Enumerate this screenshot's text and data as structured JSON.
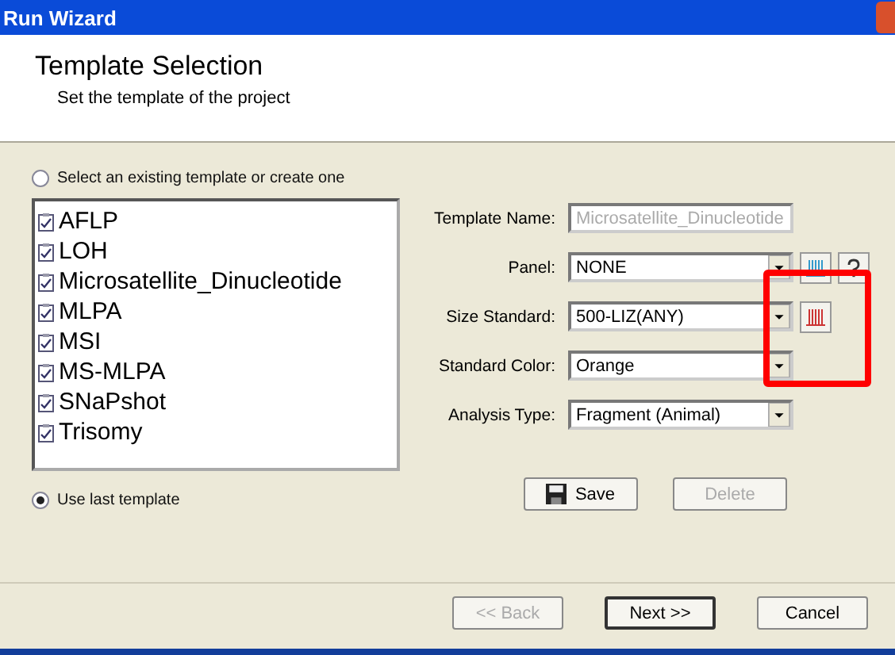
{
  "window": {
    "title": "Run Wizard"
  },
  "header": {
    "title": "Template Selection",
    "subtitle": "Set the template of the project"
  },
  "options": [
    {
      "label": "Select an existing template or create one",
      "selected": false
    },
    {
      "label": "Use last template",
      "selected": true
    }
  ],
  "templates": [
    "AFLP",
    "LOH",
    "Microsatellite_Dinucleotide",
    "MLPA",
    "MSI",
    "MS-MLPA",
    "SNaPshot",
    "Trisomy"
  ],
  "form": [
    {
      "label": "Template Name:",
      "kind": "text",
      "value": "Microsatellite_Dinucleotide",
      "disabled": true
    },
    {
      "label": "Panel:",
      "kind": "select",
      "value": "NONE",
      "disabled": false,
      "tools": [
        {
          "kind": "bars",
          "color": "#3399cc"
        },
        {
          "kind": "help"
        }
      ]
    },
    {
      "label": "Size Standard:",
      "kind": "select",
      "value": "500-LIZ(ANY)",
      "disabled": false,
      "tools": [
        {
          "kind": "bars",
          "color": "#cc3333"
        }
      ]
    },
    {
      "label": "Standard Color:",
      "kind": "select",
      "value": "Orange",
      "disabled": false
    },
    {
      "label": "Analysis Type:",
      "kind": "select",
      "value": "Fragment (Animal)",
      "disabled": false
    }
  ],
  "actions": [
    {
      "label": "Save",
      "kind": "save",
      "disabled": false
    },
    {
      "label": "Delete",
      "kind": "plain",
      "disabled": true
    }
  ],
  "nav": [
    {
      "label": "<< Back",
      "disabled": true,
      "default": false
    },
    {
      "label": "Next >>",
      "disabled": false,
      "default": true
    },
    {
      "label": "Cancel",
      "disabled": false,
      "default": false
    }
  ]
}
